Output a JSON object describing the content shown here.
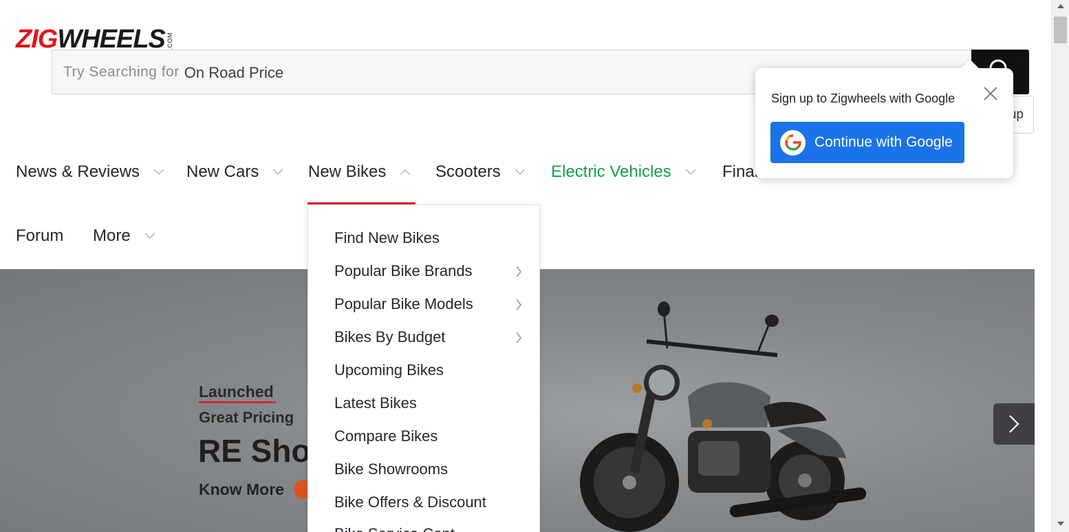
{
  "header": {
    "logo_main_red": "ZIG",
    "logo_main_dark": "WHEELS",
    "logo_suffix": ".COM",
    "search_prefix": "Try Searching for",
    "search_rotating_term": "On Road Price",
    "login_label": "up"
  },
  "nav": {
    "items": [
      {
        "label": "News & Reviews"
      },
      {
        "label": "New Cars"
      },
      {
        "label": "New Bikes"
      },
      {
        "label": "Scooters"
      },
      {
        "label": "Electric Vehicles"
      },
      {
        "label": "Finan"
      },
      {
        "label": "Forum"
      },
      {
        "label": "More"
      }
    ],
    "active": "New Bikes",
    "accent_color": "#d8232a",
    "ev_color": "#15a04a"
  },
  "dropdown": {
    "items": [
      {
        "label": "Find New Bikes"
      },
      {
        "label": "Popular Bike Brands"
      },
      {
        "label": "Popular Bike Models"
      },
      {
        "label": "Bikes By Budget"
      },
      {
        "label": "Upcoming Bikes"
      },
      {
        "label": "Latest Bikes"
      },
      {
        "label": "Compare Bikes"
      },
      {
        "label": "Bike Showrooms"
      },
      {
        "label": "Bike Offers & Discount"
      },
      {
        "label": "Bike Service Cent"
      }
    ]
  },
  "hero": {
    "tag": "Launched",
    "subtitle": "Great Pricing",
    "title": "RE Shot",
    "cta": "Know More"
  },
  "google_popup": {
    "title": "Sign up to Zigwheels with Google",
    "button_label": "Continue with Google",
    "button_color": "#1a73e8"
  }
}
